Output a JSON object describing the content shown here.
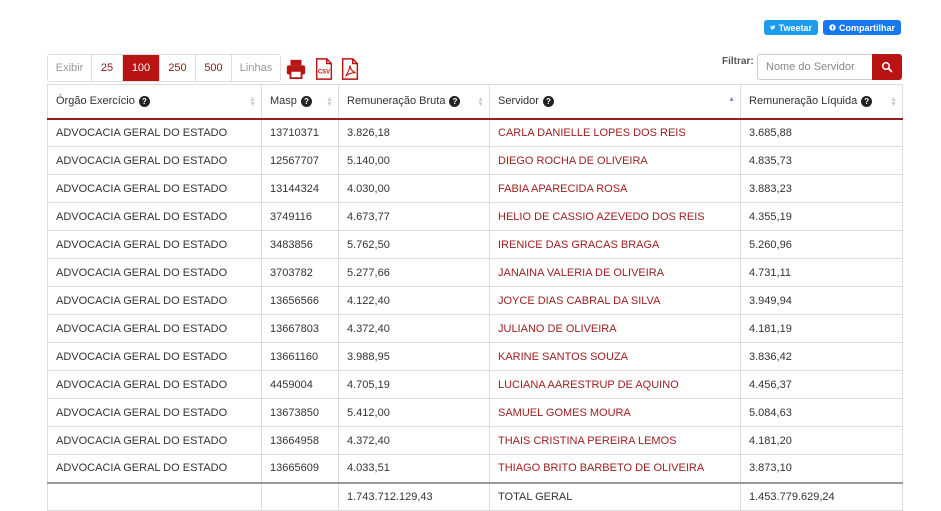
{
  "share": {
    "tweet_label": "Tweetar",
    "share_label": "Compartilhar"
  },
  "pager": {
    "label": "Exibir",
    "options": [
      "25",
      "100",
      "250",
      "500"
    ],
    "selected": "100",
    "suffix": "Linhas"
  },
  "export": {
    "csv_label": "CSV"
  },
  "filter": {
    "label": "Filtrar:",
    "placeholder": "Nome do Servidor"
  },
  "columns": [
    "Órgão Exercício",
    "Masp",
    "Remuneração Bruta",
    "Servidor",
    "Remuneração Líquida"
  ],
  "rows": [
    [
      "ADVOCACIA GERAL DO ESTADO",
      "13710371",
      "3.826,18",
      "CARLA DANIELLE LOPES DOS REIS",
      "3.685,88"
    ],
    [
      "ADVOCACIA GERAL DO ESTADO",
      "12567707",
      "5.140,00",
      "DIEGO ROCHA DE OLIVEIRA",
      "4.835,73"
    ],
    [
      "ADVOCACIA GERAL DO ESTADO",
      "13144324",
      "4.030,00",
      "FABIA APARECIDA ROSA",
      "3.883,23"
    ],
    [
      "ADVOCACIA GERAL DO ESTADO",
      "3749116",
      "4.673,77",
      "HELIO DE CASSIO AZEVEDO DOS REIS",
      "4.355,19"
    ],
    [
      "ADVOCACIA GERAL DO ESTADO",
      "3483856",
      "5.762,50",
      "IRENICE DAS GRACAS BRAGA",
      "5.260,96"
    ],
    [
      "ADVOCACIA GERAL DO ESTADO",
      "3703782",
      "5.277,66",
      "JANAINA VALERIA DE OLIVEIRA",
      "4.731,11"
    ],
    [
      "ADVOCACIA GERAL DO ESTADO",
      "13656566",
      "4.122,40",
      "JOYCE DIAS CABRAL DA SILVA",
      "3.949,94"
    ],
    [
      "ADVOCACIA GERAL DO ESTADO",
      "13667803",
      "4.372,40",
      "JULIANO DE OLIVEIRA",
      "4.181,19"
    ],
    [
      "ADVOCACIA GERAL DO ESTADO",
      "13661160",
      "3.988,95",
      "KARINE SANTOS SOUZA",
      "3.836,42"
    ],
    [
      "ADVOCACIA GERAL DO ESTADO",
      "4459004",
      "4.705,19",
      "LUCIANA AARESTRUP DE AQUINO",
      "4.456,37"
    ],
    [
      "ADVOCACIA GERAL DO ESTADO",
      "13673850",
      "5.412,00",
      "SAMUEL GOMES MOURA",
      "5.084,63"
    ],
    [
      "ADVOCACIA GERAL DO ESTADO",
      "13664958",
      "4.372,40",
      "THAIS CRISTINA PEREIRA LEMOS",
      "4.181,20"
    ],
    [
      "ADVOCACIA GERAL DO ESTADO",
      "13665609",
      "4.033,51",
      "THIAGO BRITO BARBETO DE OLIVEIRA",
      "3.873,10"
    ]
  ],
  "totals": {
    "bruta": "1.743.712.129,43",
    "label": "TOTAL GERAL",
    "liquida": "1.453.779.629,24"
  }
}
